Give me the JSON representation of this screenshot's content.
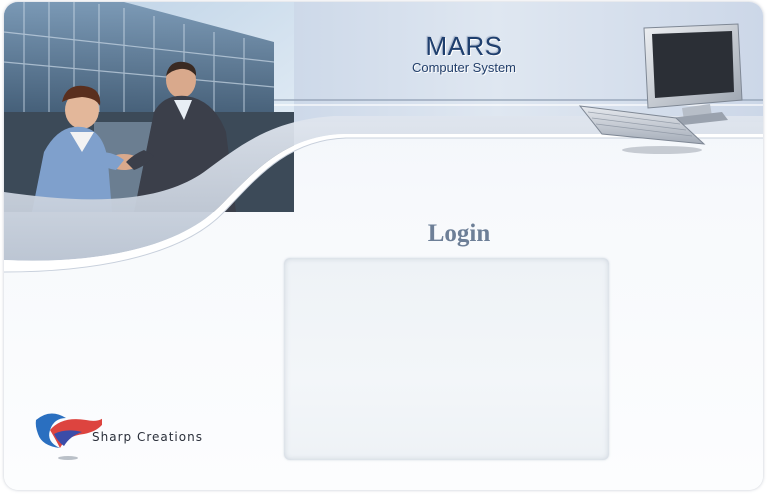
{
  "header": {
    "app_title": "MARS",
    "app_subtitle": "Computer System"
  },
  "login": {
    "heading": "Login"
  },
  "footer": {
    "brand_name": "Sharp Creations"
  },
  "colors": {
    "title": "#1f3f6e",
    "login_heading": "#6d7f97",
    "panel": "#f0f3f7"
  }
}
